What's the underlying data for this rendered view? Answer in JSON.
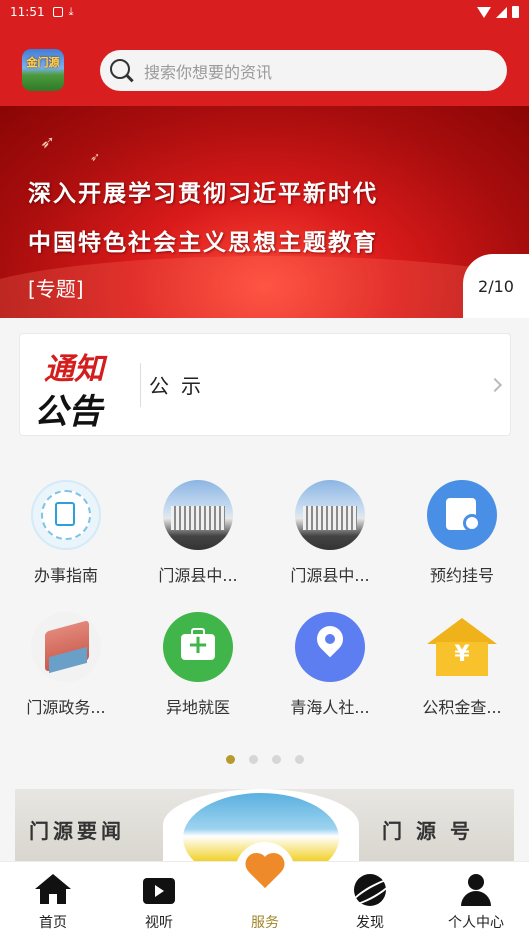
{
  "status_bar": {
    "time": "11:51"
  },
  "header": {
    "app_logo_text": "金门源",
    "search_placeholder": "搜索你想要的资讯"
  },
  "banner": {
    "line1": "深入开展学习贯彻习近平新时代",
    "line2": "中国特色社会主义思想主题教育",
    "tag": "[专题]",
    "pager": "2/10"
  },
  "notice": {
    "image_text_top": "通知",
    "image_text_bottom": "公告",
    "label": "公示"
  },
  "services": [
    {
      "label": "办事指南",
      "icon": "guide-doc-icon"
    },
    {
      "label": "门源县中...",
      "icon": "building-photo"
    },
    {
      "label": "门源县中...",
      "icon": "building-photo"
    },
    {
      "label": "预约挂号",
      "icon": "calendar-clock-icon"
    },
    {
      "label": "门源政务...",
      "icon": "government-building-icon"
    },
    {
      "label": "异地就医",
      "icon": "medical-kit-icon"
    },
    {
      "label": "青海人社...",
      "icon": "location-pin-icon"
    },
    {
      "label": "公积金查...",
      "icon": "house-yen-icon"
    }
  ],
  "pagination": {
    "count": 4,
    "active_index": 0
  },
  "news_strip": {
    "left_title": "门源要闻",
    "right_title": "门源号"
  },
  "tabbar": {
    "tabs": [
      {
        "label": "首页",
        "icon": "home-icon"
      },
      {
        "label": "视听",
        "icon": "tv-icon"
      },
      {
        "label": "服务",
        "icon": "heart-icon"
      },
      {
        "label": "发现",
        "icon": "planet-icon"
      },
      {
        "label": "个人中心",
        "icon": "user-icon"
      }
    ],
    "active_index": 2
  },
  "colors": {
    "header_red": "#d81e1e",
    "accent_gold": "#a0862a",
    "heart_orange": "#ef8a2a"
  }
}
